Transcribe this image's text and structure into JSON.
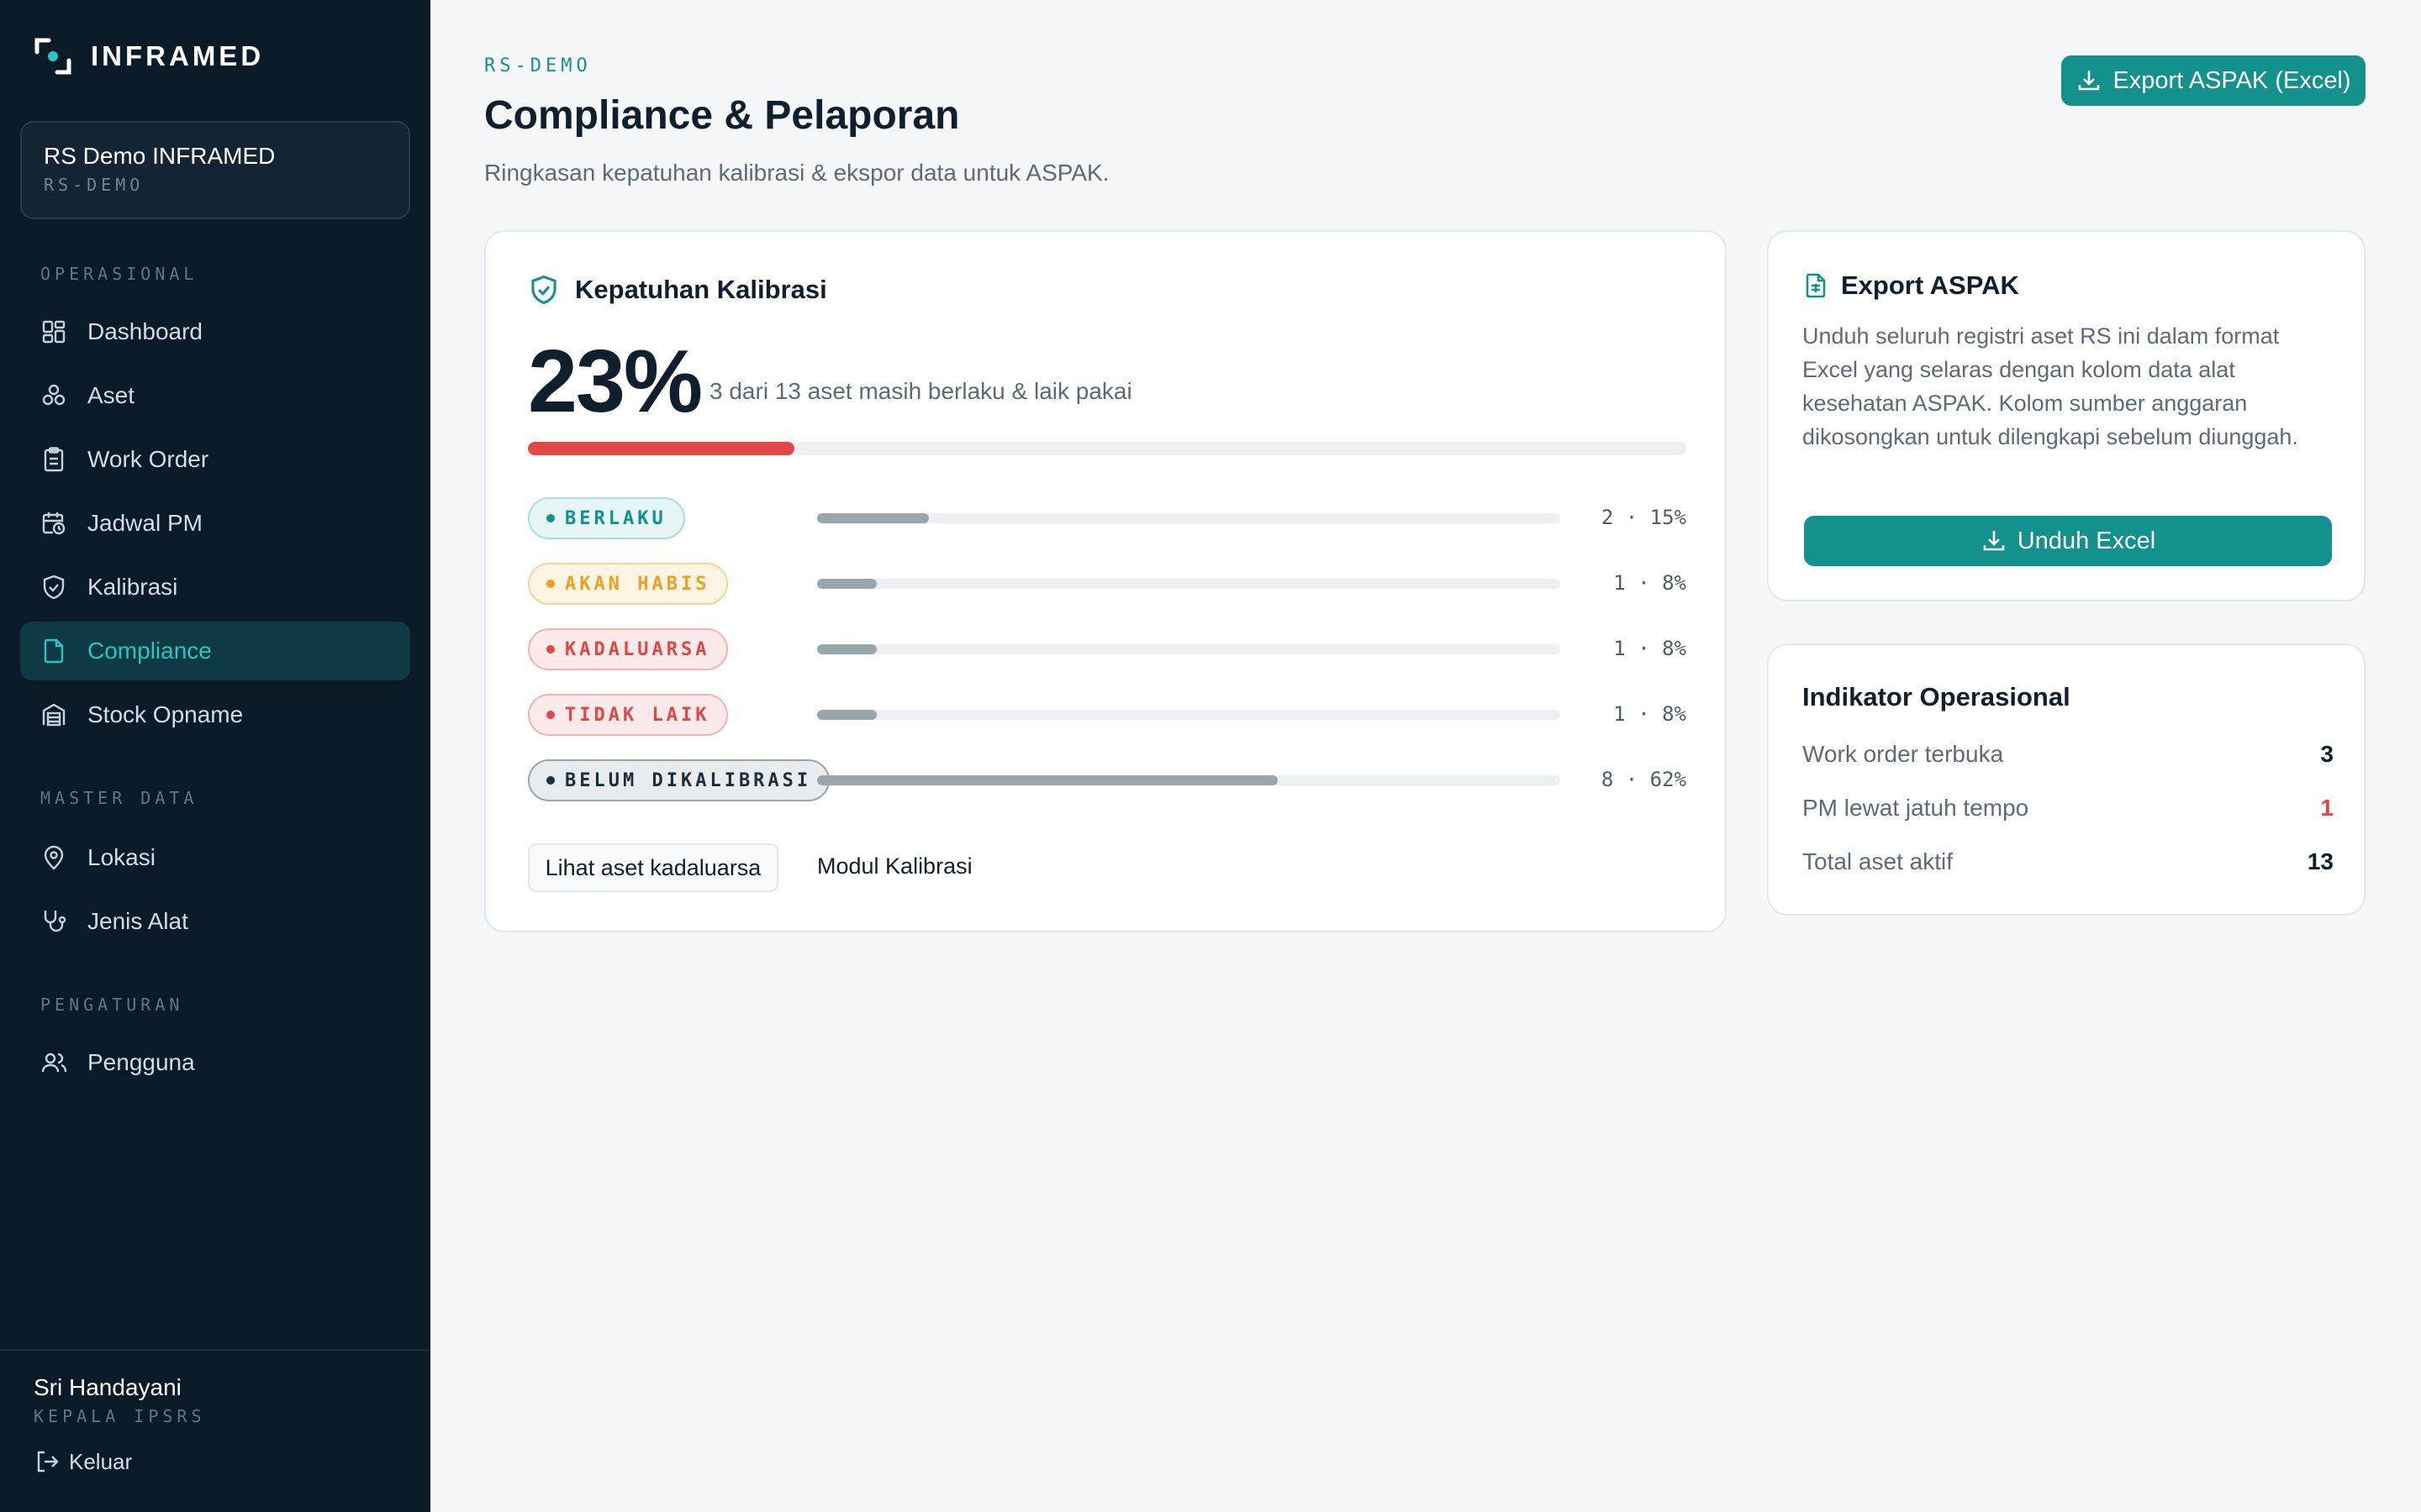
{
  "app": {
    "brand": "INFRAMED"
  },
  "org": {
    "name": "RS Demo INFRAMED",
    "code": "RS-DEMO"
  },
  "sidebar": {
    "sections": [
      {
        "label": "OPERASIONAL"
      },
      {
        "label": "MASTER DATA"
      },
      {
        "label": "PENGATURAN"
      }
    ],
    "items": [
      {
        "label": "Dashboard",
        "icon": "dashboard-icon"
      },
      {
        "label": "Aset",
        "icon": "assets-icon"
      },
      {
        "label": "Work Order",
        "icon": "clipboard-icon"
      },
      {
        "label": "Jadwal PM",
        "icon": "calendar-clock-icon"
      },
      {
        "label": "Kalibrasi",
        "icon": "shield-check-icon"
      },
      {
        "label": "Compliance",
        "icon": "document-icon",
        "active": true
      },
      {
        "label": "Stock Opname",
        "icon": "warehouse-icon"
      },
      {
        "label": "Lokasi",
        "icon": "map-pin-icon"
      },
      {
        "label": "Jenis Alat",
        "icon": "stethoscope-icon"
      },
      {
        "label": "Pengguna",
        "icon": "users-icon"
      }
    ]
  },
  "user": {
    "name": "Sri Handayani",
    "role": "KEPALA IPSRS",
    "logout_label": "Keluar"
  },
  "header": {
    "breadcrumb": "RS-DEMO",
    "title": "Compliance & Pelaporan",
    "subtitle": "Ringkasan kepatuhan kalibrasi & ekspor data untuk ASPAK.",
    "export_button": "Export ASPAK (Excel)"
  },
  "compliance": {
    "title": "Kepatuhan Kalibrasi",
    "percent_label": "23%",
    "percent": 23,
    "description": "3 dari 13 aset masih berlaku & laik pakai",
    "statuses": [
      {
        "label": "BERLAKU",
        "count_label": "2 · 15%",
        "percent": 15,
        "color": "#13918d"
      },
      {
        "label": "AKAN HABIS",
        "count_label": "1 · 8%",
        "percent": 8,
        "color": "#f0a020"
      },
      {
        "label": "KADALUARSA",
        "count_label": "1 · 8%",
        "percent": 8,
        "color": "#e04848"
      },
      {
        "label": "TIDAK LAIK",
        "count_label": "1 · 8%",
        "percent": 8,
        "color": "#e04848"
      },
      {
        "label": "BELUM DIKALIBRASI",
        "count_label": "8 · 62%",
        "percent": 62,
        "color": "#1e2e3a"
      }
    ],
    "btn_expired": "Lihat aset kadaluarsa",
    "btn_module": "Modul Kalibrasi"
  },
  "export_card": {
    "title": "Export ASPAK",
    "description": "Unduh seluruh registri aset RS ini dalam format Excel yang selaras dengan kolom data alat kesehatan ASPAK. Kolom sumber anggaran dikosongkan untuk dilengkapi sebelum diunggah.",
    "button": "Unduh Excel"
  },
  "ops": {
    "title": "Indikator Operasional",
    "rows": [
      {
        "label": "Work order terbuka",
        "value": "3"
      },
      {
        "label": "PM lewat jatuh tempo",
        "value": "1"
      },
      {
        "label": "Total aset aktif",
        "value": "13"
      }
    ]
  },
  "colors": {
    "accent": "#13918d",
    "sidebar_bg": "#0b1a27",
    "danger": "#e04848",
    "warning": "#f0a020"
  }
}
